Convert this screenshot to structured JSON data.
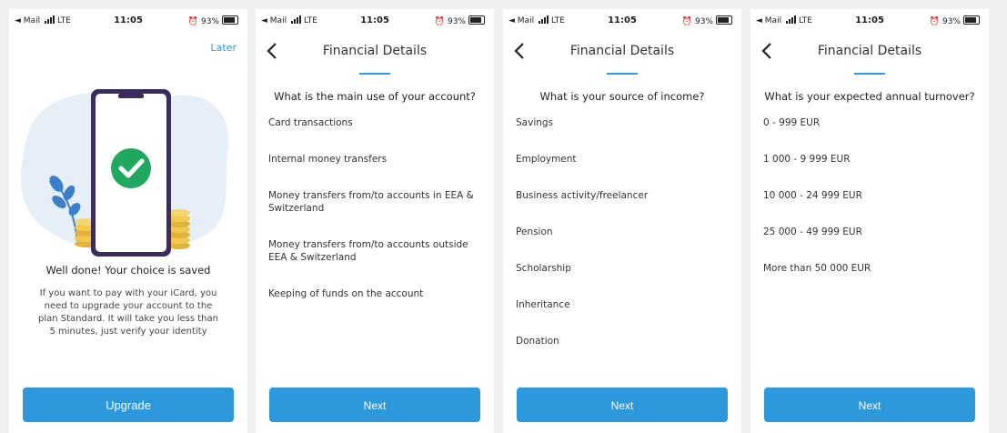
{
  "status_bar": {
    "carrier": "◄ Mail",
    "network": "LTE",
    "time": "11:05",
    "battery": "93%"
  },
  "screen1": {
    "later": "Later",
    "title": "Well done! Your choice is saved",
    "body": "If you want to pay with your iCard, you need to upgrade your account to the plan Standard. It will take you less than 5 minutes, just verify your identity",
    "button": "Upgrade"
  },
  "screen2": {
    "header": "Financial Details",
    "question": "What is the main use of your account?",
    "options": [
      "Card transactions",
      "Internal money transfers",
      "Money transfers from/to accounts in EEA & Switzerland",
      "Money transfers from/to accounts outside EEA & Switzerland",
      "Keeping of funds on the account"
    ],
    "button": "Next"
  },
  "screen3": {
    "header": "Financial Details",
    "question": "What is your source of income?",
    "options": [
      "Savings",
      "Employment",
      "Business activity/freelancer",
      "Pension",
      "Scholarship",
      "Inheritance",
      "Donation"
    ],
    "button": "Next"
  },
  "screen4": {
    "header": "Financial Details",
    "question": "What is your expected annual turnover?",
    "options": [
      "0 - 999 EUR",
      "1 000 - 9 999 EUR",
      "10 000 - 24 999 EUR",
      "25 000 - 49 999 EUR",
      "More than 50 000 EUR"
    ],
    "button": "Next"
  },
  "colors": {
    "accent": "#2e98dc",
    "check": "#21a85f",
    "phone_frame": "#3a2d5c",
    "coins": "#f2c94c",
    "blob": "#e6eef8",
    "leaves": "#3b7fc9"
  },
  "icons": [
    "back-chevron-icon",
    "checkmark-icon",
    "signal-icon",
    "battery-icon",
    "alarm-icon"
  ]
}
